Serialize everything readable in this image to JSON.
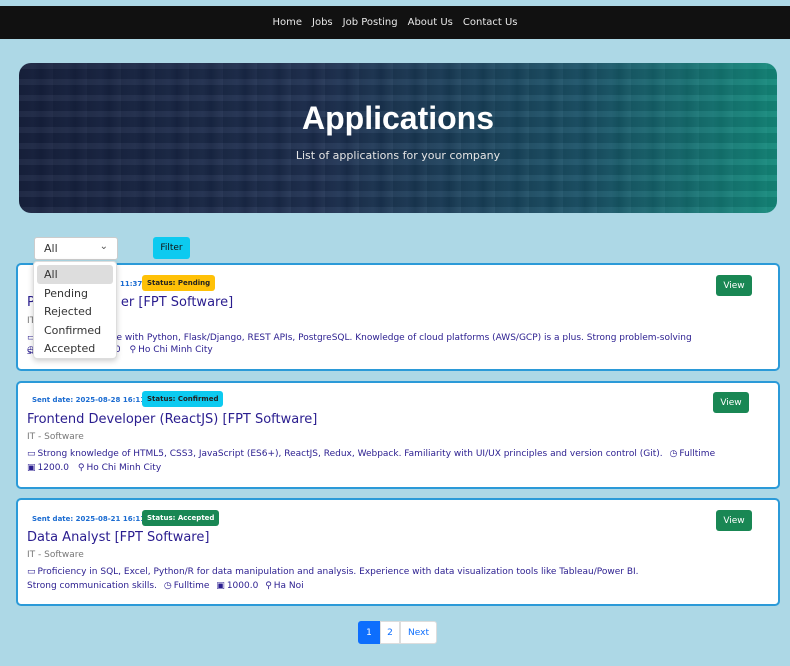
{
  "nav": {
    "items": [
      "Home",
      "Jobs",
      "Job Posting",
      "About Us",
      "Contact Us"
    ]
  },
  "hero": {
    "title": "Applications",
    "subtitle": "List of applications for your company"
  },
  "filter": {
    "selected": "All",
    "button_label": "Filter",
    "options": [
      "All",
      "Pending",
      "Rejected",
      "Confirmed",
      "Accepted"
    ]
  },
  "applications": [
    {
      "sent": "Sent date: 2025-09-?? 16:11:37",
      "sent_visible": "11:37",
      "status": "Status: Pending",
      "title_visible": "er [FPT Software]",
      "title_prefix": "P",
      "category_visible": "IT",
      "desc_visible": "ce with Python, Flask/Django, REST APIs, PostgreSQL. Knowledge of cloud platforms (AWS/GCP) is a plus. Strong problem-solving skills.",
      "salary_visible": "0",
      "location": "Ho Chi Minh City",
      "view_label": "View"
    },
    {
      "sent": "Sent date: 2025-08-28 16:11:37",
      "status": "Status: Confirmed",
      "title": "Frontend Developer (ReactJS) [FPT Software]",
      "category": "IT - Software",
      "desc": "Strong knowledge of HTML5, CSS3, JavaScript (ES6+), ReactJS, Redux, Webpack. Familiarity with UI/UX principles and version control (Git).",
      "type": "Fulltime",
      "salary": "1200.0",
      "location": "Ho Chi Minh City",
      "view_label": "View"
    },
    {
      "sent": "Sent date: 2025-08-21 16:11:37",
      "status": "Status: Accepted",
      "title": "Data Analyst [FPT Software]",
      "category": "IT - Software",
      "desc": "Proficiency in SQL, Excel, Python/R for data manipulation and analysis. Experience with data visualization tools like Tableau/Power BI. Strong communication skills.",
      "type": "Fulltime",
      "salary": "1000.0",
      "location": "Ha Noi",
      "view_label": "View"
    }
  ],
  "pagination": {
    "pages": [
      "1",
      "2"
    ],
    "next_label": "Next",
    "current": "1"
  },
  "colors": {
    "background": "#add8e6",
    "navbar": "#111111",
    "card_border": "#2b9ad8",
    "view_button": "#198754",
    "pending": "#ffc107",
    "confirmed": "#0dcaf0",
    "accepted": "#198754",
    "link": "#2a1d8f"
  }
}
